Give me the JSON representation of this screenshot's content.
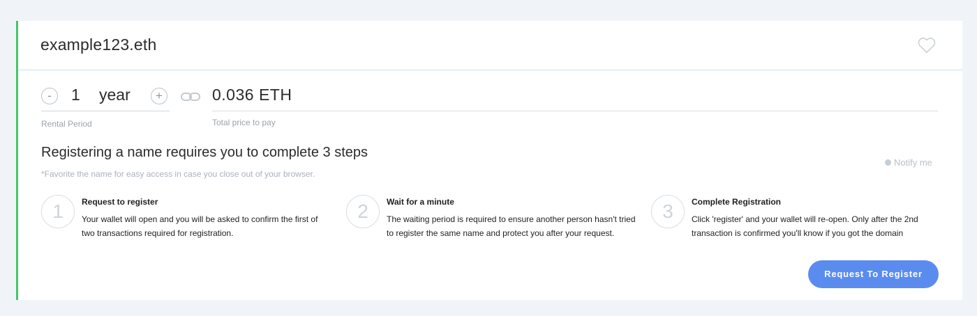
{
  "domain": "example123.eth",
  "rental": {
    "minus_label": "-",
    "plus_label": "+",
    "years": "1",
    "unit": "year",
    "label": "Rental Period"
  },
  "price": {
    "value": "0.036 ETH",
    "label": "Total price to pay"
  },
  "steps_section": {
    "title": "Registering a name requires you to complete 3 steps",
    "note": "*Favorite the name for easy access in case you close out of your browser.",
    "notify_label": "Notify me"
  },
  "steps": [
    {
      "number": "1",
      "title": "Request to register",
      "description": "Your wallet will open and you will be asked to confirm the first of two transactions required for registration."
    },
    {
      "number": "2",
      "title": "Wait for a minute",
      "description": "The waiting period is required to ensure another person hasn't tried to register the same name and protect you after your request."
    },
    {
      "number": "3",
      "title": "Complete Registration",
      "description": "Click 'register' and your wallet will re-open. Only after the 2nd transaction is confirmed you'll know if you got the domain"
    }
  ],
  "register_button": "Request To Register",
  "icons": {
    "favorite": "heart-icon",
    "link": "link-icon",
    "notify": "bell-icon"
  },
  "colors": {
    "accent_border": "#42c66b",
    "button": "#5a8cf0"
  }
}
